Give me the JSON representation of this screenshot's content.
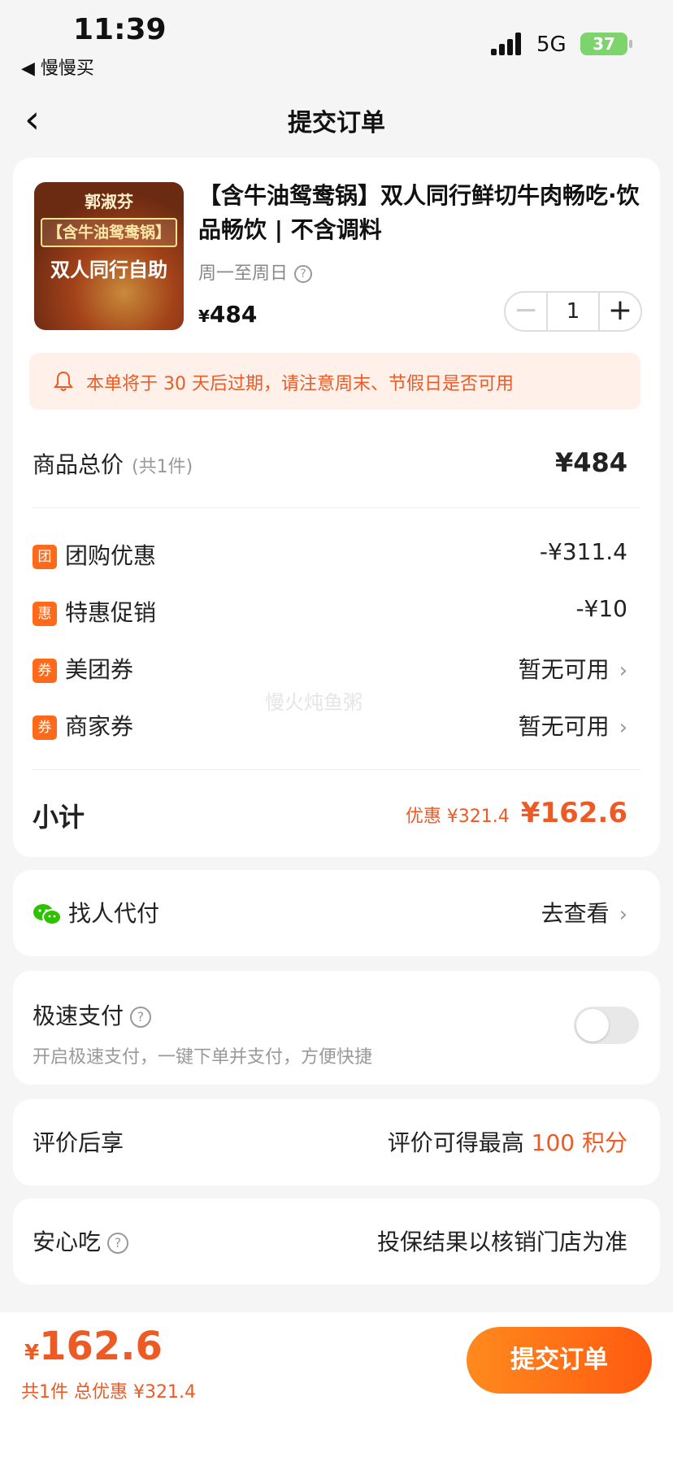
{
  "status_bar": {
    "time": "11:39",
    "back_app": "◀ 慢慢买",
    "network": "5G",
    "battery": "37"
  },
  "nav": {
    "back_icon": "chevron-left-icon",
    "title": "提交订单"
  },
  "product": {
    "image_brand": "郭淑芬",
    "image_tag": "【含牛油鸳鸯锅】",
    "image_tag2": "双人同行自助",
    "title": "【含牛油鸳鸯锅】双人同行鲜切牛肉畅吃·饮品畅饮 | 不含调料",
    "days": "周一至周日",
    "price_symbol": "¥",
    "price": "484",
    "quantity": "1"
  },
  "notice": {
    "icon": "bell-icon",
    "text": "本单将于 30 天后过期，请注意周末、节假日是否可用"
  },
  "summary": {
    "total_label": "商品总价",
    "total_count": "(共1件)",
    "total_value": "¥484",
    "discounts": [
      {
        "badge": "团",
        "label": "团购优惠",
        "value": "-¥311.4"
      },
      {
        "badge": "惠",
        "label": "特惠促销",
        "value": "-¥10"
      },
      {
        "badge": "券",
        "label": "美团券",
        "value": "暂无可用"
      },
      {
        "badge": "券",
        "label": "商家券",
        "value": "暂无可用"
      }
    ],
    "subtotal_label": "小计",
    "subtotal_discount": "优惠 ¥321.4",
    "subtotal_value": "¥162.6"
  },
  "watermark": "慢火炖鱼粥",
  "pay_for_me": {
    "label": "找人代付",
    "action": "去查看"
  },
  "fast_pay": {
    "label": "极速支付",
    "desc": "开启极速支付，一键下单并支付，方便快捷",
    "enabled": false
  },
  "review": {
    "label": "评价后享",
    "text_prefix": "评价可得最高 ",
    "text_highlight": "100 积分"
  },
  "safe": {
    "label": "安心吃",
    "text": "投保结果以核销门店为准"
  },
  "bottom": {
    "price_symbol": "¥",
    "price": "162.6",
    "sub": "共1件 总优惠 ¥321.4",
    "submit": "提交订单"
  },
  "colors": {
    "accent": "#ee5a24",
    "button_start": "#ff8a1e",
    "button_end": "#ff5a0f",
    "background": "#f5f5f5"
  }
}
